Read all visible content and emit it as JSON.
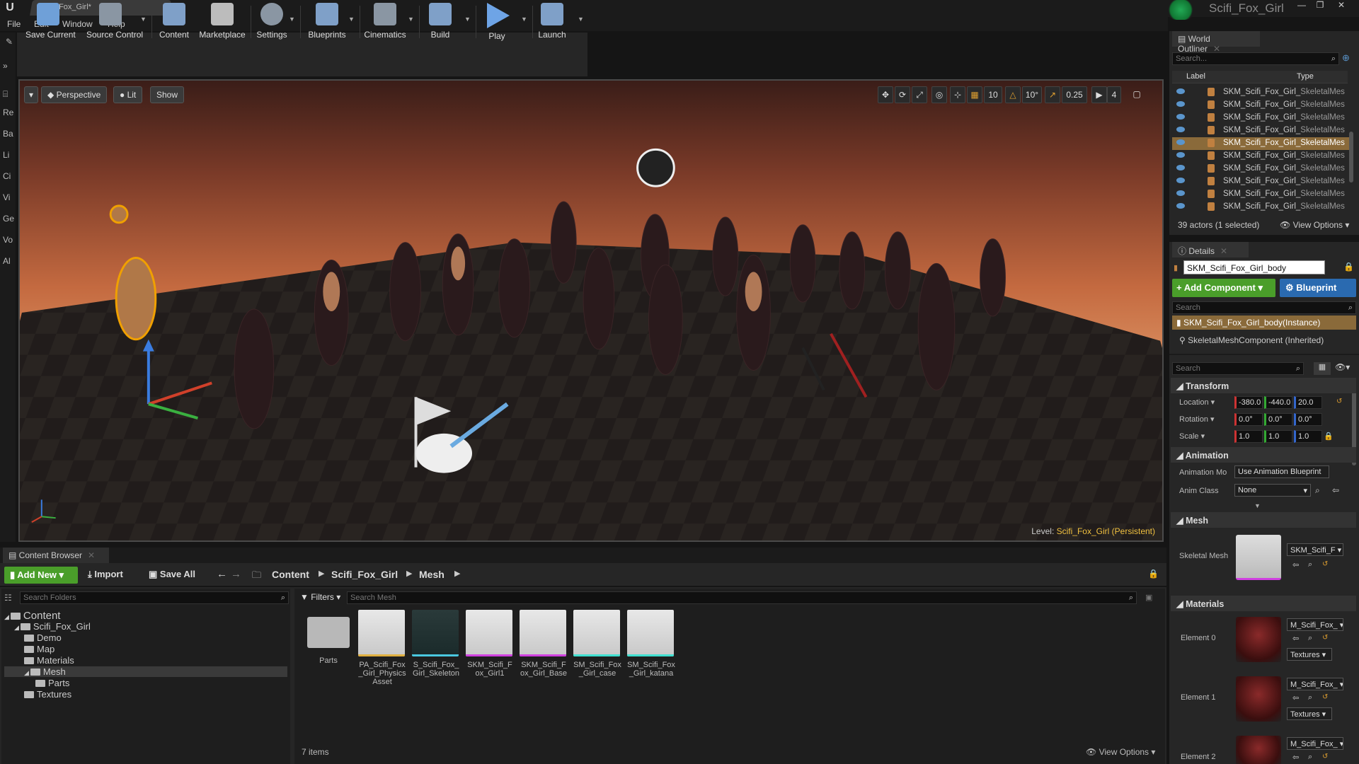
{
  "title_bar": {
    "doc_tab": "Scifi_Fox_Girl*",
    "project_name": "Scifi_Fox_Girl"
  },
  "menu": [
    "File",
    "Edit",
    "Window",
    "Help"
  ],
  "toolbar": [
    {
      "label": "Save Current",
      "color": "#7fb3e6"
    },
    {
      "label": "Source Control",
      "color": "#9aa6b3"
    },
    {
      "label": "Content",
      "color": "#8fb0d8"
    },
    {
      "label": "Marketplace",
      "color": "#c8c8c8"
    },
    {
      "label": "Settings",
      "color": "#9aa6b3"
    },
    {
      "label": "Blueprints",
      "color": "#8fb0d8"
    },
    {
      "label": "Cinematics",
      "color": "#9aa6b3"
    },
    {
      "label": "Build",
      "color": "#8fb0d8"
    },
    {
      "label": "Play",
      "color": "#6ea4e6"
    },
    {
      "label": "Launch",
      "color": "#8fb0d8"
    }
  ],
  "mode_strip": [
    "Re",
    "Ba",
    "Li",
    "Ci",
    "Vi",
    "Ge",
    "Vo",
    "Al"
  ],
  "viewport": {
    "perspective": "Perspective",
    "lit": "Lit",
    "show": "Show",
    "grid_snap": "10",
    "rot_snap": "10°",
    "scale_snap": "0.25",
    "cam_speed": "4",
    "level_label": "Level:",
    "level_name": "Scifi_Fox_Girl (Persistent)"
  },
  "world_outliner": {
    "tab": "World Outliner",
    "search_placeholder": "Search...",
    "col_label": "Label",
    "col_type": "Type",
    "rows": [
      {
        "label": "SKM_Scifi_Fox_Girl_",
        "type": "SkeletalMes",
        "selected": false
      },
      {
        "label": "SKM_Scifi_Fox_Girl_",
        "type": "SkeletalMes",
        "selected": false
      },
      {
        "label": "SKM_Scifi_Fox_Girl_",
        "type": "SkeletalMes",
        "selected": false
      },
      {
        "label": "SKM_Scifi_Fox_Girl_",
        "type": "SkeletalMes",
        "selected": false
      },
      {
        "label": "SKM_Scifi_Fox_Girl_",
        "type": "SkeletalMes",
        "selected": true
      },
      {
        "label": "SKM_Scifi_Fox_Girl_",
        "type": "SkeletalMes",
        "selected": false
      },
      {
        "label": "SKM_Scifi_Fox_Girl_",
        "type": "SkeletalMes",
        "selected": false
      },
      {
        "label": "SKM_Scifi_Fox_Girl_",
        "type": "SkeletalMes",
        "selected": false
      },
      {
        "label": "SKM_Scifi_Fox_Girl_",
        "type": "SkeletalMes",
        "selected": false
      },
      {
        "label": "SKM_Scifi_Fox_Girl_",
        "type": "SkeletalMes",
        "selected": false
      }
    ],
    "status": "39 actors (1 selected)",
    "view_options": "View Options"
  },
  "details": {
    "tab": "Details",
    "actor_name": "SKM_Scifi_Fox_Girl_body",
    "add_component": "+ Add Component",
    "blueprint": "Blueprint",
    "search_placeholder": "Search",
    "instance": "SKM_Scifi_Fox_Girl_body(Instance)",
    "component": "SkeletalMeshComponent (Inherited)",
    "search2_placeholder": "Search",
    "transform": {
      "title": "Transform",
      "location_label": "Location",
      "location": [
        "-380.0",
        "-440.0",
        "20.0"
      ],
      "rotation_label": "Rotation",
      "rotation": [
        "0.0°",
        "0.0°",
        "0.0°"
      ],
      "scale_label": "Scale",
      "scale": [
        "1.0",
        "1.0",
        "1.0"
      ]
    },
    "animation": {
      "title": "Animation",
      "mode_label": "Animation Mo",
      "mode_value": "Use Animation Blueprint",
      "class_label": "Anim Class",
      "class_value": "None"
    },
    "mesh": {
      "title": "Mesh",
      "skeletal_mesh_label": "Skeletal Mesh",
      "skeletal_mesh_value": "SKM_Scifi_F"
    },
    "materials": {
      "title": "Materials",
      "items": [
        {
          "label": "Element 0",
          "value": "M_Scifi_Fox_",
          "textures": "Textures"
        },
        {
          "label": "Element 1",
          "value": "M_Scifi_Fox_",
          "textures": "Textures"
        },
        {
          "label": "Element 2",
          "value": "M_Scifi_Fox_",
          "textures": ""
        }
      ]
    }
  },
  "content_browser": {
    "tab": "Content Browser",
    "add_new": "Add New",
    "import": "Import",
    "save_all": "Save All",
    "path": [
      "Content",
      "Scifi_Fox_Girl",
      "Mesh"
    ],
    "search_folders_placeholder": "Search Folders",
    "filters": "Filters",
    "search_mesh_placeholder": "Search Mesh",
    "tree": [
      {
        "label": "Content",
        "level": 0
      },
      {
        "label": "Scifi_Fox_Girl",
        "level": 1
      },
      {
        "label": "Demo",
        "level": 2
      },
      {
        "label": "Map",
        "level": 2
      },
      {
        "label": "Materials",
        "level": 2
      },
      {
        "label": "Mesh",
        "level": 2
      },
      {
        "label": "Parts",
        "level": 3
      },
      {
        "label": "Textures",
        "level": 2
      }
    ],
    "assets": [
      {
        "name": "Parts",
        "strip": ""
      },
      {
        "name": "PA_Scifi_Fox_Girl_Physics Asset",
        "strip": "#e0b040"
      },
      {
        "name": "S_Scifi_Fox_Girl_Skeleton",
        "strip": "#4ac8e0"
      },
      {
        "name": "SKM_Scifi_Fox_Girl1",
        "strip": "#d040e0"
      },
      {
        "name": "SKM_Scifi_Fox_Girl_Base",
        "strip": "#d040e0"
      },
      {
        "name": "SM_Scifi_Fox_Girl_case",
        "strip": "#40e0d0"
      },
      {
        "name": "SM_Scifi_Fox_Girl_katana",
        "strip": "#40e0d0"
      }
    ],
    "item_count": "7 items",
    "view_options": "View Options"
  }
}
